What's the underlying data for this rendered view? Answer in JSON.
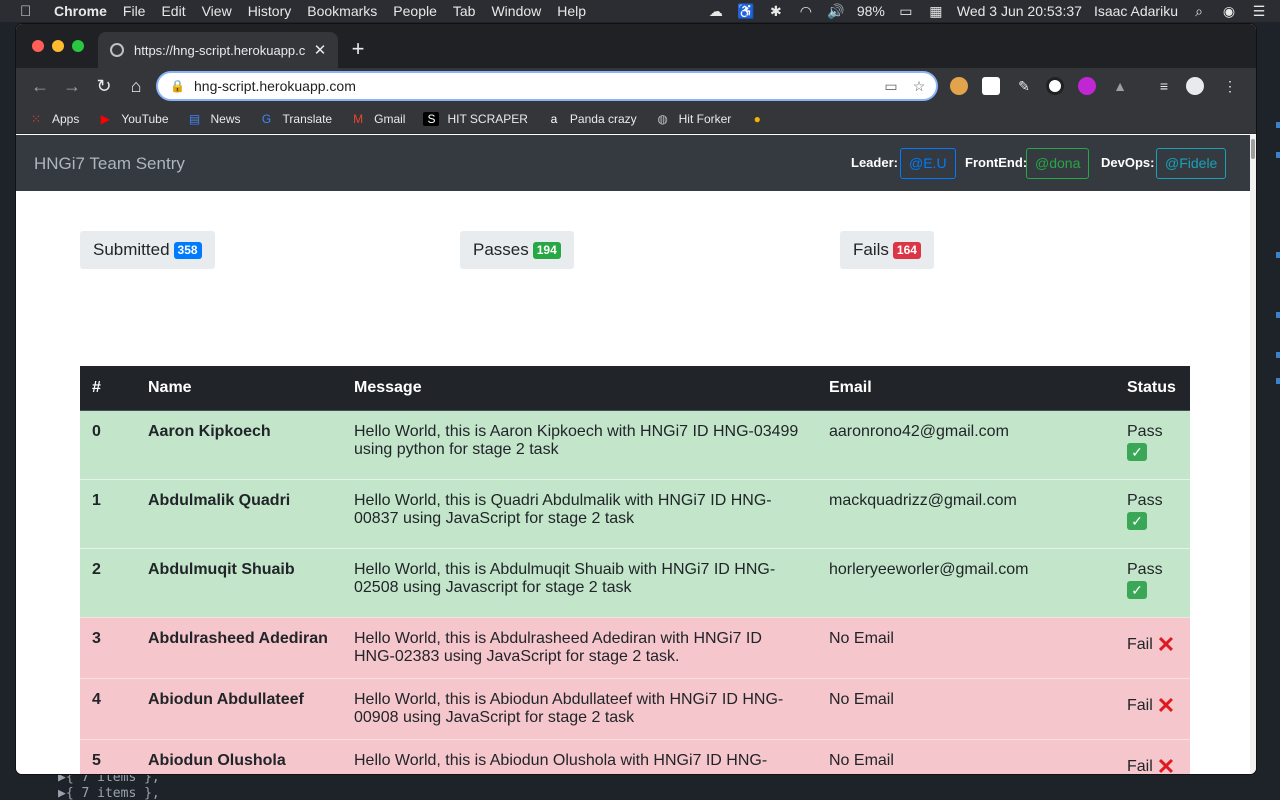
{
  "menubar": {
    "apple": "",
    "items": [
      "Chrome",
      "File",
      "Edit",
      "View",
      "History",
      "Bookmarks",
      "People",
      "Tab",
      "Window",
      "Help"
    ],
    "battery": "98%",
    "datetime": "Wed 3 Jun  20:53:37",
    "user": "Isaac Adariku"
  },
  "browser": {
    "tab_title": "https://hng-script.herokuapp.c",
    "url": "hng-script.herokuapp.com",
    "bookmarks": [
      {
        "label": "Apps",
        "icon": "apps-grid-icon",
        "color": "#ea4335"
      },
      {
        "label": "YouTube",
        "icon": "youtube-icon",
        "color": "#ff0000"
      },
      {
        "label": "News",
        "icon": "news-icon",
        "color": "#4285f4"
      },
      {
        "label": "Translate",
        "icon": "translate-icon",
        "color": "#4285f4"
      },
      {
        "label": "Gmail",
        "icon": "gmail-icon",
        "color": "#ea4335"
      },
      {
        "label": "HIT SCRAPER",
        "icon": "hit-scraper-icon",
        "color": "#ffffff"
      },
      {
        "label": "Panda crazy",
        "icon": "amazon-icon",
        "color": "#ffffff"
      },
      {
        "label": "Hit Forker",
        "icon": "globe-icon",
        "color": "#bdc1c6"
      },
      {
        "label": "",
        "icon": "accessibility-icon",
        "color": "#f5b300"
      }
    ]
  },
  "site": {
    "brand": "HNGi7 Team Sentry",
    "leader_label": "Leader:",
    "leader_handle": "@E.U",
    "frontend_label": "FrontEnd:",
    "frontend_handle": "@dona",
    "devops_label": "DevOps:",
    "devops_handle": "@Fidele"
  },
  "stats": {
    "submitted_label": "Submitted",
    "submitted_count": "358",
    "passes_label": "Passes",
    "passes_count": "194",
    "fails_label": "Fails",
    "fails_count": "164"
  },
  "colors": {
    "primary": "#007bff",
    "success": "#28a745",
    "danger": "#dc3545",
    "info": "#17a2b8",
    "pass_row": "#c3e6cb",
    "fail_row": "#f5c6cb"
  },
  "table": {
    "headers": [
      "#",
      "Name",
      "Message",
      "Email",
      "Status"
    ],
    "rows": [
      {
        "idx": "0",
        "name": "Aaron Kipkoech",
        "message": "Hello World, this is Aaron Kipkoech with HNGi7 ID HNG-03499 using python for stage 2 task",
        "email": "aaronrono42@gmail.com",
        "status": "Pass",
        "result": "pass"
      },
      {
        "idx": "1",
        "name": "Abdulmalik Quadri",
        "message": "Hello World, this is Quadri Abdulmalik with HNGi7 ID HNG-00837 using JavaScript for stage 2 task",
        "email": "mackquadrizz@gmail.com",
        "status": "Pass",
        "result": "pass"
      },
      {
        "idx": "2",
        "name": "Abdulmuqit Shuaib",
        "message": "Hello World, this is Abdulmuqit Shuaib with HNGi7 ID HNG-02508 using Javascript for stage 2 task",
        "email": "horleryeeworler@gmail.com",
        "status": "Pass",
        "result": "pass"
      },
      {
        "idx": "3",
        "name": "Abdulrasheed Adediran",
        "message": "Hello World, this is Abdulrasheed Adediran with HNGi7 ID HNG-02383 using JavaScript for stage 2 task.",
        "email": "No Email",
        "status": "Fail",
        "result": "fail"
      },
      {
        "idx": "4",
        "name": "Abiodun Abdullateef",
        "message": "Hello World, this is Abiodun Abdullateef with HNGi7 ID HNG-00908 using JavaScript for stage 2 task",
        "email": "No Email",
        "status": "Fail",
        "result": "fail"
      },
      {
        "idx": "5",
        "name": "Abiodun Olushola",
        "message": "Hello World, this is Abiodun Olushola with HNGi7 ID HNG-",
        "email": "No Email",
        "status": "Fail",
        "result": "fail"
      }
    ]
  },
  "background_code": {
    "line1": "▶{  7 items  },",
    "line2": "▶{  7 items  },"
  }
}
